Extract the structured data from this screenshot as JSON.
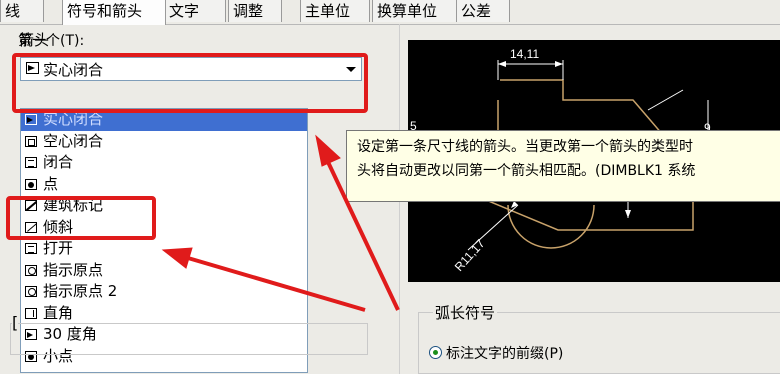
{
  "tabs": [
    "线",
    "符号和箭头",
    "文字",
    "调整",
    "主单位",
    "换算单位",
    "公差"
  ],
  "arrowhead_group": {
    "title": "箭头",
    "first_label": "第一个(T):",
    "first_value": "实心闭合"
  },
  "arrow_list": [
    {
      "label": "实心闭合",
      "icon": "solid-closed-arrow-icon",
      "selected": true
    },
    {
      "label": "空心闭合",
      "icon": "hollow-closed-arrow-icon"
    },
    {
      "label": "闭合",
      "icon": "closed-arrow-icon"
    },
    {
      "label": "点",
      "icon": "dot-icon"
    },
    {
      "label": "建筑标记",
      "icon": "architectural-tick-icon"
    },
    {
      "label": "倾斜",
      "icon": "oblique-icon"
    },
    {
      "label": "打开",
      "icon": "open-arrow-icon"
    },
    {
      "label": "指示原点",
      "icon": "origin-indicator-icon"
    },
    {
      "label": "指示原点 2",
      "icon": "origin-indicator-2-icon"
    },
    {
      "label": "直角",
      "icon": "right-angle-icon"
    },
    {
      "label": "30 度角",
      "icon": "open-30-icon"
    },
    {
      "label": "小点",
      "icon": "dot-small-icon"
    }
  ],
  "tooltip": {
    "line1": "设定第一条尺寸线的箭头。当更改第一个箭头的类型时",
    "line2": "头将自动更改以同第一个箭头相匹配。(DIMBLK1 系统"
  },
  "preview": {
    "dim_top": "14,11",
    "dim_radius": "R11,17",
    "dim_left": "5",
    "dim_right": "9"
  },
  "arc_group": {
    "title": "弧长符号",
    "option1": "标注文字的前缀(P)"
  },
  "colors": {
    "highlight": "#e01b1b",
    "selection": "#3f6fd1",
    "drawing": "#c8a26a"
  }
}
